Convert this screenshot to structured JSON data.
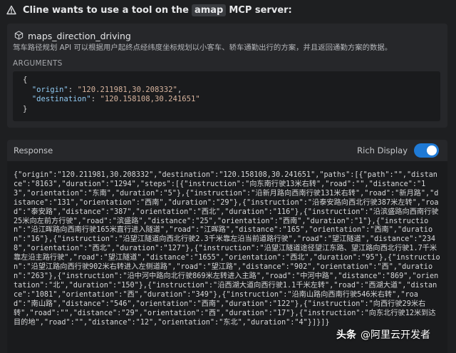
{
  "header": {
    "prefix": "Cline wants to use a tool on the",
    "server": "amap",
    "suffix": "MCP server:"
  },
  "tool": {
    "name": "maps_direction_driving",
    "description": "驾车路径规划 API 可以根据用户起终点经纬度坐标规划以小客车、轿车通勤出行的方案，并且返回通勤方案的数据。",
    "arguments_label": "ARGUMENTS",
    "args": {
      "open": "{",
      "origin_key": "\"origin\"",
      "origin_val": "\"120.211981,30.208332\"",
      "destination_key": "\"destination\"",
      "destination_val": "\"120.158108,30.241651\"",
      "close": "}"
    }
  },
  "response": {
    "label": "Response",
    "rich_display_label": "Rich Display",
    "rich_display_on": true,
    "text": "{\"origin\":\"120.211981,30.208332\",\"destination\":\"120.158108,30.241651\",\"paths\":[{\"path\":\"\",\"distance\":\"8163\",\"duration\":\"1294\",\"steps\":[{\"instruction\":\"向东南行驶13米右转\",\"road\":\"\",\"distance\":\"13\",\"orientation\":\"东南\",\"duration\":\"5\"},{\"instruction\":\"沿新月路向西南行驶131米右转\",\"road\":\"新月路\",\"distance\":\"131\",\"orientation\":\"西南\",\"duration\":\"29\"},{\"instruction\":\"沿泰安路向西北行驶387米左转\",\"road\":\"泰安路\",\"distance\":\"387\",\"orientation\":\"西北\",\"duration\":\"116\"},{\"instruction\":\"沿滨盛路向西南行驶25米向左前方行驶\",\"road\":\"滨盛路\",\"distance\":\"25\",\"orientation\":\"西南\",\"duration\":\"1\"},{\"instruction\":\"沿江晖路向西南行驶165米直行进入隧道\",\"road\":\"江晖路\",\"distance\":\"165\",\"orientation\":\"西南\",\"duration\":\"16\"},{\"instruction\":\"沿望江隧道向西北行驶2.3千米靠左沿当前道路行驶\",\"road\":\"望江隧道\",\"distance\":\"2348\",\"orientation\":\"西北\",\"duration\":\"127\"},{\"instruction\":\"沿望江隧道途径望江东路、望江路向西北行驶1.7千米靠左沿主路行驶\",\"road\":\"望江隧道\",\"distance\":\"1655\",\"orientation\":\"西北\",\"duration\":\"95\"},{\"instruction\":\"沿望江路向西行驶902米右转进入左侧道路\",\"road\":\"望江路\",\"distance\":\"902\",\"orientation\":\"西\",\"duration\":\"263\"},{\"instruction\":\"沿中河中路向北行驶869米左转进入主路\",\"road\":\"中河中路\",\"distance\":\"869\",\"orientation\":\"北\",\"duration\":\"150\"},{\"instruction\":\"沿西湖大道向西行驶1.1千米左转\",\"road\":\"西湖大道\",\"distance\":\"1081\",\"orientation\":\"西\",\"duration\":\"349\"},{\"instruction\":\"沿南山路向西南行驶546米右转\",\"road\":\"南山路\",\"distance\":\"546\",\"orientation\":\"西南\",\"duration\":\"122\"},{\"instruction\":\"向西行驶29米右转\",\"road\":\"\",\"distance\":\"29\",\"orientation\":\"西\",\"duration\":\"17\"},{\"instruction\":\"向东北行驶12米到达目的地\",\"road\":\"\",\"distance\":\"12\",\"orientation\":\"东北\",\"duration\":\"4\"}]}]}"
  },
  "watermark": {
    "brand": "头条",
    "account": "@阿里云开发者"
  },
  "colors": {
    "background": "#1e1f21",
    "panel": "#26272a",
    "code_bg": "#1a1b1d",
    "toggle_on": "#1f7ad6",
    "key": "#8fc8f0",
    "string": "#d7b49e"
  },
  "icons": {
    "header": "warning-triangle-icon",
    "tool": "cube-icon"
  }
}
